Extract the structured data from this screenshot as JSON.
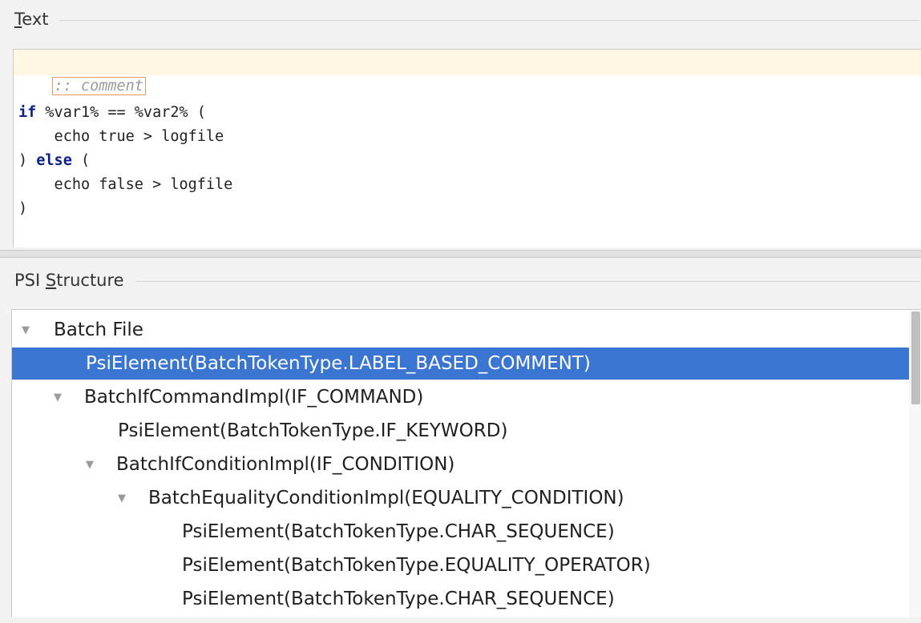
{
  "text_section": {
    "title_mnemonic": "T",
    "title_rest": "ext"
  },
  "editor": {
    "comment": ":: comment",
    "line_if_kw": "if",
    "line_if_rest": " %var1% == %var2% (",
    "line_echo_true": "    echo true > logfile",
    "line_else_pre": ") ",
    "line_else_kw": "else",
    "line_else_post": " (",
    "line_echo_false": "    echo false > logfile",
    "line_close": ")"
  },
  "psi_section": {
    "title_pre": "PSI ",
    "title_mnemonic": "S",
    "title_rest": "tructure"
  },
  "tree": {
    "nodes": [
      {
        "label": "Batch File",
        "expanded": true
      },
      {
        "label": "PsiElement(BatchTokenType.LABEL_BASED_COMMENT)",
        "selected": true
      },
      {
        "label": "BatchIfCommandImpl(IF_COMMAND)",
        "expanded": true
      },
      {
        "label": "PsiElement(BatchTokenType.IF_KEYWORD)"
      },
      {
        "label": "BatchIfConditionImpl(IF_CONDITION)",
        "expanded": true
      },
      {
        "label": "BatchEqualityConditionImpl(EQUALITY_CONDITION)",
        "expanded": true
      },
      {
        "label": "PsiElement(BatchTokenType.CHAR_SEQUENCE)"
      },
      {
        "label": "PsiElement(BatchTokenType.EQUALITY_OPERATOR)"
      },
      {
        "label": "PsiElement(BatchTokenType.CHAR_SEQUENCE)"
      }
    ]
  },
  "colors": {
    "selection": "#3a76d1",
    "keyword": "#0b1f8a",
    "caret_line": "#fdf7e4",
    "comment_border": "#e29a62"
  }
}
